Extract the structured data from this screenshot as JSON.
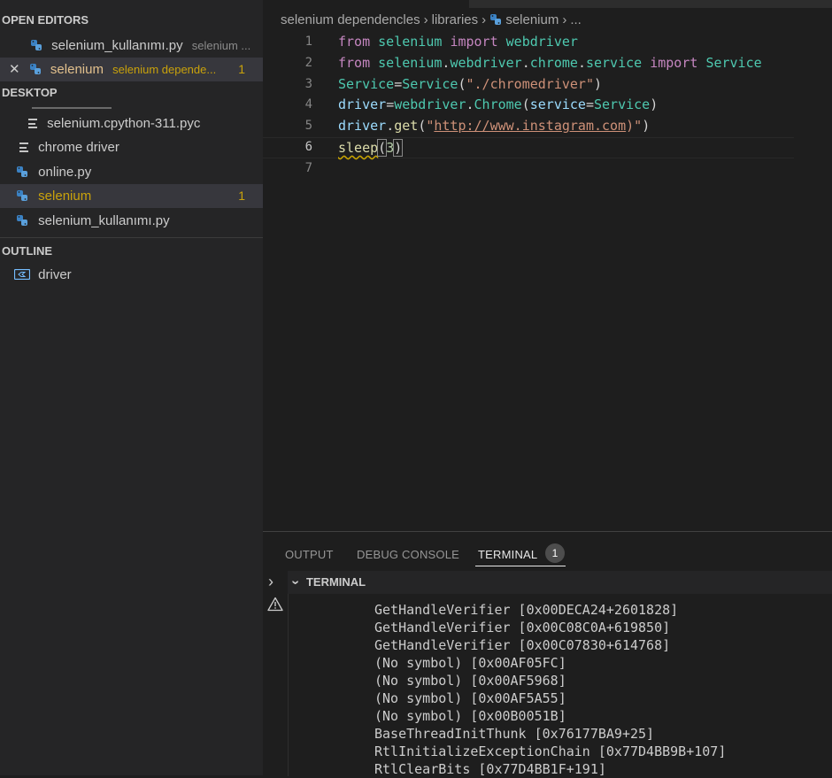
{
  "sidebar": {
    "open_editors_title": "OPEN EDITORS",
    "open_editors": [
      {
        "name": "selenium_kullanımı.py",
        "desc": "selenium ..."
      },
      {
        "name": "selenium",
        "desc": "selenium depende...",
        "badge": "1"
      }
    ],
    "desktop_title": "DESKTOP",
    "files": [
      {
        "name": "selenium.cpython-311.pyc"
      },
      {
        "name": "chrome driver"
      },
      {
        "name": "online.py"
      },
      {
        "name": "selenium",
        "badge": "1"
      },
      {
        "name": "selenium_kullanımı.py"
      }
    ],
    "outline_title": "OUTLINE",
    "outline_items": [
      {
        "name": "driver"
      }
    ]
  },
  "editor": {
    "breadcrumb": [
      "selenium dependencles",
      "libraries",
      "selenium",
      "..."
    ],
    "line_numbers": [
      "1",
      "2",
      "3",
      "4",
      "5",
      "6",
      "7"
    ],
    "current_line": 6
  },
  "panel": {
    "tabs": [
      "OUTPUT",
      "DEBUG CONSOLE",
      "TERMINAL"
    ],
    "terminal_badge": "1",
    "terminal_header": "TERMINAL",
    "terminal_lines": [
      "GetHandleVerifier [0x00DECA24+2601828]",
      "GetHandleVerifier [0x00C08C0A+619850]",
      "GetHandleVerifier [0x00C07830+614768]",
      "(No symbol) [0x00AF05FC]",
      "(No symbol) [0x00AF5968]",
      "(No symbol) [0x00AF5A55]",
      "(No symbol) [0x00B0051B]",
      "BaseThreadInitThunk [0x76177BA9+25]",
      "RtlInitializeExceptionChain [0x77D4BB9B+107]",
      "RtlClearBits [0x77D4BB1F+191]"
    ]
  },
  "colors": {
    "keyword": "#c586c0",
    "module": "#4ec9b0",
    "variable": "#9cdcfe",
    "function": "#dcdcaa",
    "string": "#ce9178",
    "modified": "#c9a20b"
  }
}
